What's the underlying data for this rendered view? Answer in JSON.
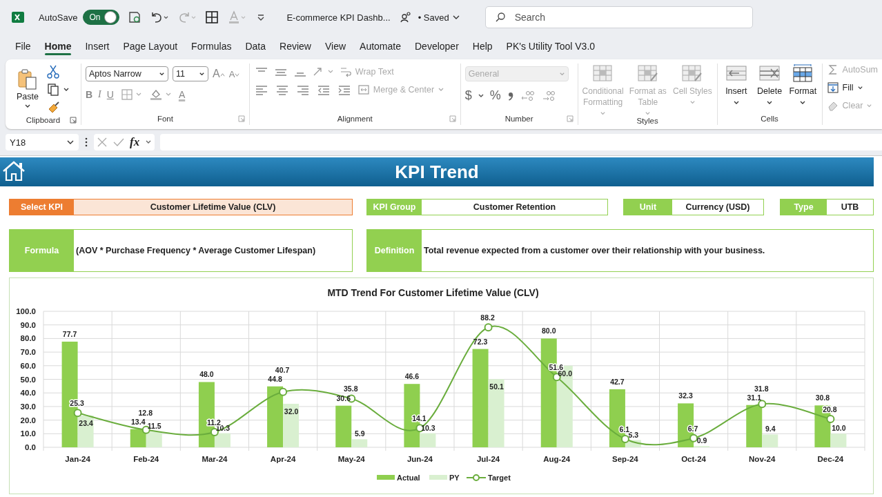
{
  "title_bar": {
    "autosave_label": "AutoSave",
    "autosave": {
      "label": "On",
      "on": true
    },
    "document_title": "E-commerce KPI Dashb...",
    "save_status": "• Saved",
    "search_placeholder": "Search"
  },
  "menu_tabs": [
    {
      "label": "File",
      "selected": false
    },
    {
      "label": "Home",
      "selected": true
    },
    {
      "label": "Insert",
      "selected": false
    },
    {
      "label": "Page Layout",
      "selected": false
    },
    {
      "label": "Formulas",
      "selected": false
    },
    {
      "label": "Data",
      "selected": false
    },
    {
      "label": "Review",
      "selected": false
    },
    {
      "label": "View",
      "selected": false
    },
    {
      "label": "Automate",
      "selected": false
    },
    {
      "label": "Developer",
      "selected": false
    },
    {
      "label": "Help",
      "selected": false
    },
    {
      "label": "PK's Utility Tool V3.0",
      "selected": false
    }
  ],
  "ribbon": {
    "clipboard": {
      "label": "Clipboard",
      "paste": "Paste"
    },
    "font": {
      "label": "Font",
      "font_name": "Aptos Narrow",
      "font_size": "11",
      "grow": "A",
      "shrink": "A",
      "bold": "B",
      "italic": "I",
      "underline": "U",
      "font_color": "A"
    },
    "alignment": {
      "label": "Alignment",
      "wrap_text": {
        "label": "Wrap Text",
        "disabled": true
      },
      "merge_center": {
        "label": "Merge & Center",
        "disabled": true
      }
    },
    "number": {
      "label": "Number",
      "format": {
        "value": "General",
        "disabled": true
      },
      "currency": "$",
      "percent": "%"
    },
    "styles": {
      "label": "Styles",
      "buttons": [
        {
          "label": "Conditional Formatting",
          "disabled": true
        },
        {
          "label": "Format as Table",
          "disabled": true
        },
        {
          "label": "Cell Styles",
          "disabled": true
        }
      ]
    },
    "cells": {
      "label": "Cells",
      "buttons": [
        {
          "label": "Insert",
          "kind": "insert"
        },
        {
          "label": "Delete",
          "kind": "delete"
        },
        {
          "label": "Format",
          "kind": "format"
        }
      ]
    },
    "editing": {
      "buttons": [
        {
          "label": "AutoSum",
          "kind": "sum",
          "disabled": true
        },
        {
          "label": "Fill",
          "kind": "fill",
          "disabled": false
        },
        {
          "label": "Clear",
          "kind": "clear",
          "disabled": true
        }
      ]
    }
  },
  "formula_bar": {
    "name_box": "Y18",
    "fx": "fx"
  },
  "sheet": {
    "title": "KPI Trend",
    "fields": [
      {
        "label": "Select KPI",
        "value": "Customer Lifetime Value (CLV)",
        "kind": "selector"
      },
      {
        "label": "KPI Group",
        "value": "Customer Retention",
        "kind": "info"
      },
      {
        "label": "Unit",
        "value": "Currency (USD)",
        "kind": "info"
      },
      {
        "label": "Type",
        "value": "UTB",
        "kind": "info"
      }
    ],
    "formula": {
      "label": "Formula",
      "value": "(AOV * Purchase Frequency * Average Customer Lifespan)"
    },
    "definition": {
      "label": "Definition",
      "value": "Total revenue expected from a customer over their relationship with your business."
    },
    "chart_data": {
      "type": "bar",
      "title": "MTD Trend For Customer Lifetime Value (CLV)",
      "categories": [
        "Jan-24",
        "Feb-24",
        "Mar-24",
        "Apr-24",
        "May-24",
        "Jun-24",
        "Jul-24",
        "Aug-24",
        "Sep-24",
        "Oct-24",
        "Nov-24",
        "Dec-24"
      ],
      "series": [
        {
          "name": "Actual",
          "type": "bar",
          "color": "#8fcf4f",
          "values": [
            77.7,
            13.4,
            48.0,
            44.8,
            30.6,
            46.6,
            72.3,
            80.0,
            42.7,
            32.3,
            31.1,
            30.8
          ],
          "value_labels": [
            "77.7",
            "13.4",
            "48.0",
            "44.8",
            "30.6",
            "46.6",
            "72.3",
            "80.0",
            "42.7",
            "32.3",
            "31.1",
            "30.8"
          ]
        },
        {
          "name": "PY",
          "type": "bar",
          "color": "#d9f0d0",
          "values": [
            23.4,
            11.5,
            10.3,
            32.0,
            5.9,
            10.3,
            50.1,
            60.0,
            5.3,
            0.9,
            9.4,
            10.0
          ],
          "value_labels": [
            "23.4",
            "11.5",
            "10.3",
            "32.0",
            "5.9",
            "10.3",
            "50.1",
            "60.0",
            "5.3",
            "0.9",
            "9.4",
            "10.0"
          ]
        },
        {
          "name": "Target",
          "type": "line",
          "marker": "circle",
          "color": "#6aad3d",
          "values": [
            25.3,
            12.8,
            11.2,
            40.7,
            35.8,
            14.1,
            88.2,
            51.6,
            6.1,
            6.7,
            31.8,
            20.8
          ],
          "value_labels": [
            "25.3",
            "12.8",
            "11.2",
            "40.7",
            "35.8",
            "14.1",
            "88.2",
            "51.6",
            "6.1",
            "6.7",
            "31.8",
            "20.8"
          ]
        }
      ],
      "ylim": [
        0,
        100
      ],
      "yticks": [
        {
          "value": 0,
          "label": "0.0"
        },
        {
          "value": 10,
          "label": "10.0"
        },
        {
          "value": 20,
          "label": "20.0"
        },
        {
          "value": 30,
          "label": "30.0"
        },
        {
          "value": 40,
          "label": "40.0"
        },
        {
          "value": 50,
          "label": "50.0"
        },
        {
          "value": 60,
          "label": "60.0"
        },
        {
          "value": 70,
          "label": "70.0"
        },
        {
          "value": 80,
          "label": "80.0"
        },
        {
          "value": 90,
          "label": "90.0"
        },
        {
          "value": 100,
          "label": "100.0"
        }
      ],
      "grid": true,
      "legend": "bottom",
      "data_labels": true
    }
  }
}
